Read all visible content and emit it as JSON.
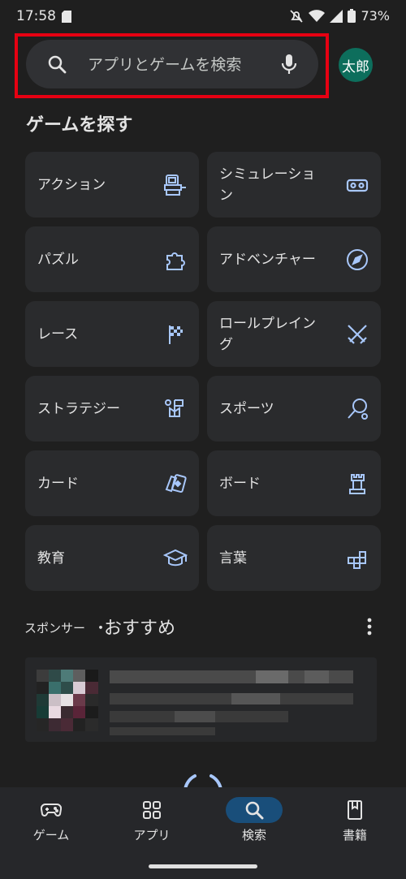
{
  "status_bar": {
    "time": "17:58",
    "battery_percent": "73%",
    "icons": [
      "sd-card-icon",
      "mute-icon",
      "wifi-icon",
      "signal-icon",
      "battery-icon"
    ]
  },
  "search": {
    "placeholder": "アプリとゲームを検索",
    "avatar_text": "太郎",
    "highlight_color": "#e60012"
  },
  "section": {
    "title": "ゲームを探す"
  },
  "categories": [
    {
      "label": "アクション",
      "icon": "arcade-cabinet-icon"
    },
    {
      "label": "シミュレーション",
      "icon": "vr-headset-icon"
    },
    {
      "label": "パズル",
      "icon": "puzzle-piece-icon"
    },
    {
      "label": "アドベンチャー",
      "icon": "compass-icon"
    },
    {
      "label": "レース",
      "icon": "checkered-flag-icon"
    },
    {
      "label": "ロールプレイング",
      "icon": "crossed-swords-icon"
    },
    {
      "label": "ストラテジー",
      "icon": "strategy-flag-icon"
    },
    {
      "label": "スポーツ",
      "icon": "racket-icon"
    },
    {
      "label": "カード",
      "icon": "playing-cards-icon"
    },
    {
      "label": "ボード",
      "icon": "chess-rook-icon"
    },
    {
      "label": "教育",
      "icon": "graduation-cap-icon"
    },
    {
      "label": "言葉",
      "icon": "letter-blocks-icon"
    }
  ],
  "sponsored": {
    "label": "スポンサー",
    "separator": "・",
    "title": "おすすめ"
  },
  "bottom_nav": [
    {
      "label": "ゲーム",
      "icon": "gamepad-icon",
      "active": false
    },
    {
      "label": "アプリ",
      "icon": "apps-grid-icon",
      "active": false
    },
    {
      "label": "検索",
      "icon": "search-icon",
      "active": true
    },
    {
      "label": "書籍",
      "icon": "book-icon",
      "active": false
    }
  ],
  "colors": {
    "background": "#1f1f1f",
    "tile": "#2a2b2d",
    "icon_blue": "#a8c7fa",
    "active_pill": "#194e7a"
  }
}
